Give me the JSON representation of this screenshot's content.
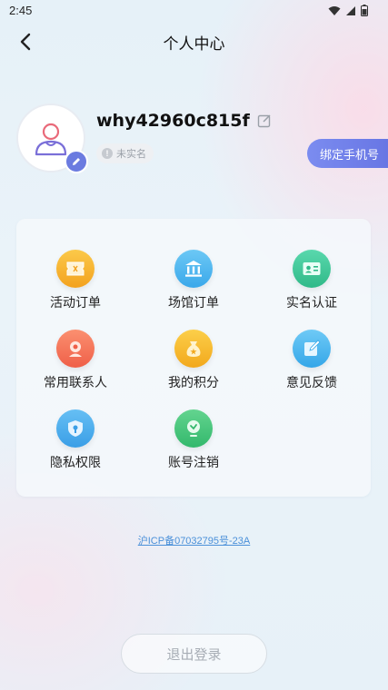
{
  "status_bar": {
    "time": "2:45"
  },
  "header": {
    "title": "个人中心"
  },
  "profile": {
    "username": "why42960c815f",
    "verify_status": "未实名",
    "verify_info_glyph": "!",
    "bind_phone_label": "绑定手机号"
  },
  "menu": {
    "items": [
      {
        "label": "活动订单",
        "icon": "ticket-icon",
        "color": "#f7b22e"
      },
      {
        "label": "场馆订单",
        "icon": "venue-building-icon",
        "color": "#4fb6f0"
      },
      {
        "label": "实名认证",
        "icon": "id-card-icon",
        "color": "#3cc79a"
      },
      {
        "label": "常用联系人",
        "icon": "contact-person-icon",
        "color": "#f4775a"
      },
      {
        "label": "我的积分",
        "icon": "points-bag-icon",
        "color": "#f5b82a"
      },
      {
        "label": "意见反馈",
        "icon": "feedback-edit-icon",
        "color": "#3fb4ec"
      },
      {
        "label": "隐私权限",
        "icon": "privacy-shield-icon",
        "color": "#42a9ea"
      },
      {
        "label": "账号注销",
        "icon": "account-cancel-icon",
        "color": "#41c67c"
      }
    ]
  },
  "footer": {
    "icp_text": "沪ICP备07032795号-23A",
    "logout_label": "退出登录"
  },
  "colors": {
    "accent": "#6b7be0",
    "link": "#4a90d9"
  }
}
